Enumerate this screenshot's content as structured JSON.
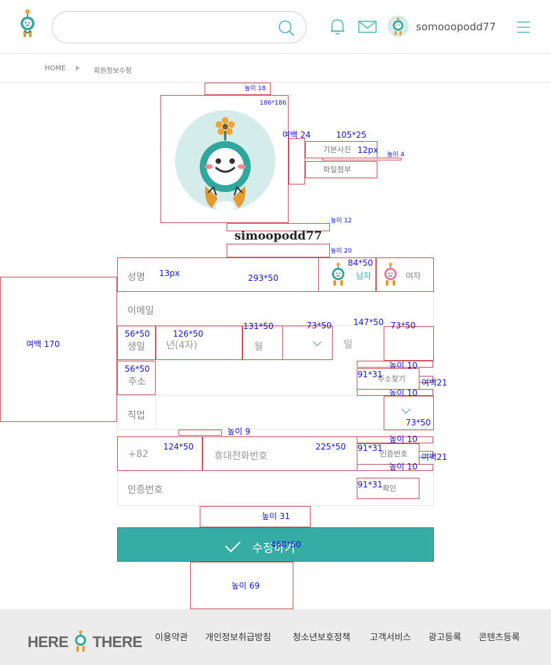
{
  "header": {
    "search_placeholder": "",
    "username": "somooopodd77"
  },
  "breadcrumb": {
    "home": "HOME",
    "current": "회원정보수정"
  },
  "profile": {
    "default_photo_label": "기본사진",
    "attach_label": "파일첨부",
    "name": "simoopodd77"
  },
  "form": {
    "name_label": "성명",
    "gender_male": "남자",
    "gender_female": "여자",
    "email_label": "이메일",
    "birth_label": "생일",
    "year_placeholder": "년(4자)",
    "month_placeholder": "월",
    "day_placeholder": "일",
    "address_label": "주소",
    "address_search": "주소찾기",
    "job_label": "직업",
    "country_code": "+82",
    "phone_placeholder": "휴대전화번호",
    "verify_request": "인증번호",
    "verify_label": "인증번호",
    "verify_confirm": "확인",
    "submit": "수정하기"
  },
  "footer": {
    "brand_left": "HERE",
    "brand_right": "THERE",
    "links": [
      "이용약관",
      "개인정보취급방침",
      "청소년보호정책",
      "고객서비스",
      "광고등록",
      "콘텐츠등록"
    ]
  },
  "spec_notes": {
    "h18": "높이 18",
    "size186": "186*186",
    "margin24": "여백 24",
    "size105": "105*25",
    "font12": "12px",
    "h4": "높이 4",
    "h12": "높이 12",
    "h20": "높이 20",
    "size84": "84*50",
    "font13": "13px",
    "size293": "293*50",
    "margin170": "여백 170",
    "size56a": "56*50",
    "size126": "126*50",
    "size131": "131*50",
    "size73a": "73*50",
    "size147": "147*50",
    "size73b": "73*50",
    "size56b": "56*50",
    "h10a": "높이 10",
    "size91a": "91*31",
    "margin21a": "여백21",
    "h10b": "높이 10",
    "size73c": "73*50",
    "h9": "높이 9",
    "size124": "124*50",
    "size225": "225*50",
    "h10c": "높이 10",
    "size91b": "91*31",
    "margin21b": "여백21",
    "h10d": "높이 10",
    "size91c": "91*31",
    "h31": "높이 31",
    "size460": "460*50",
    "h69": "높이 69"
  },
  "colors": {
    "accent": "#36ada4",
    "spec_border": "#c9535d",
    "spec_text": "#1515cc"
  }
}
